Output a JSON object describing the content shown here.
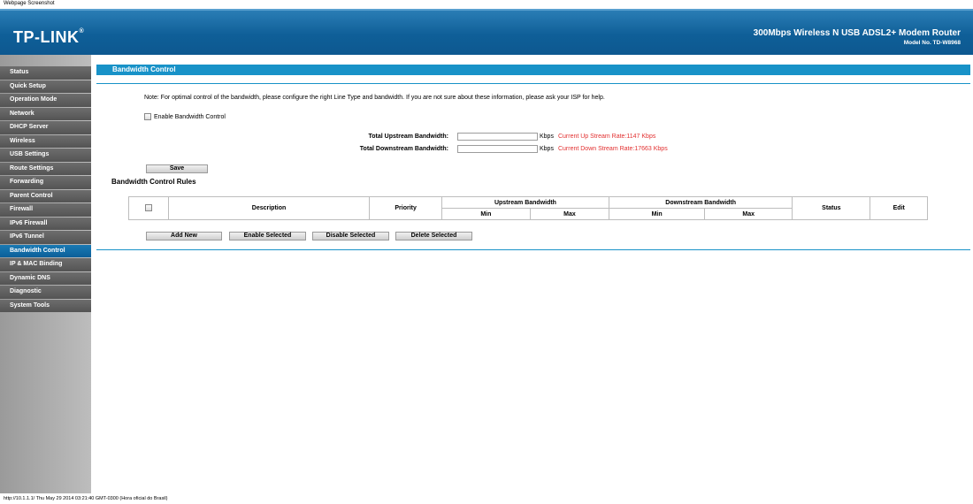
{
  "screenshot_label": "Webpage Screenshot",
  "header": {
    "logo": "TP-LINK",
    "product": "300Mbps Wireless N USB ADSL2+ Modem Router",
    "model": "Model No. TD-W8968"
  },
  "sidebar": {
    "items": [
      {
        "label": "Status"
      },
      {
        "label": "Quick Setup"
      },
      {
        "label": "Operation Mode"
      },
      {
        "label": "Network"
      },
      {
        "label": "DHCP Server"
      },
      {
        "label": "Wireless"
      },
      {
        "label": "USB Settings"
      },
      {
        "label": "Route Settings"
      },
      {
        "label": "Forwarding"
      },
      {
        "label": "Parent Control"
      },
      {
        "label": "Firewall"
      },
      {
        "label": "IPv6 Firewall"
      },
      {
        "label": "IPv6 Tunnel"
      },
      {
        "label": "Bandwidth Control",
        "active": true
      },
      {
        "label": "IP & MAC Binding"
      },
      {
        "label": "Dynamic DNS"
      },
      {
        "label": "Diagnostic"
      },
      {
        "label": "System Tools"
      }
    ]
  },
  "main": {
    "title": "Bandwidth Control",
    "note": "Note: For optimal control of the bandwidth, please configure the right Line Type and bandwidth. If you are not sure about these information, please ask your ISP for help.",
    "enable_label": "Enable Bandwidth Control",
    "enable_checked": false,
    "upstream": {
      "label": "Total Upstream Bandwidth:",
      "value": "",
      "unit": "Kbps",
      "rate": "Current Up Stream Rate:1147 Kbps"
    },
    "downstream": {
      "label": "Total Downstream Bandwidth:",
      "value": "",
      "unit": "Kbps",
      "rate": "Current Down Stream Rate:17663 Kbps"
    },
    "save_label": "Save",
    "rules_title": "Bandwidth Control Rules",
    "table": {
      "description": "Description",
      "priority": "Priority",
      "upstream": "Upstream Bandwidth",
      "downstream": "Downstream Bandwidth",
      "min": "Min",
      "max": "Max",
      "status": "Status",
      "edit": "Edit"
    },
    "buttons": {
      "add_new": "Add New",
      "enable_selected": "Enable Selected",
      "disable_selected": "Disable Selected",
      "delete_selected": "Delete Selected"
    }
  },
  "status_bar": "http://10.1.1.1/ Thu May 29 2014 03:21:40 GMT-0300 (Hora oficial do Brasil)",
  "colors": {
    "header_blue": "#0f5f98",
    "title_bar_blue": "#1892c8",
    "menu_gray": "#5e5e5e",
    "menu_active": "#0c5f99",
    "rate_red": "#e23030"
  }
}
